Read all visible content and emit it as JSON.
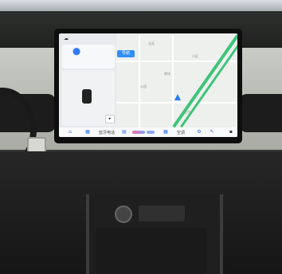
{
  "screen": {
    "cta_label": "导航",
    "map_labels": [
      "北苑",
      "小区",
      "商场",
      "公园",
      "北京"
    ],
    "dock": {
      "text_left": "蓝牙电话",
      "text_mid": "空调"
    }
  },
  "colors": {
    "accent": "#2f8ff5",
    "highway": "#3fc47a",
    "dock_pink": "#f46fa3"
  }
}
